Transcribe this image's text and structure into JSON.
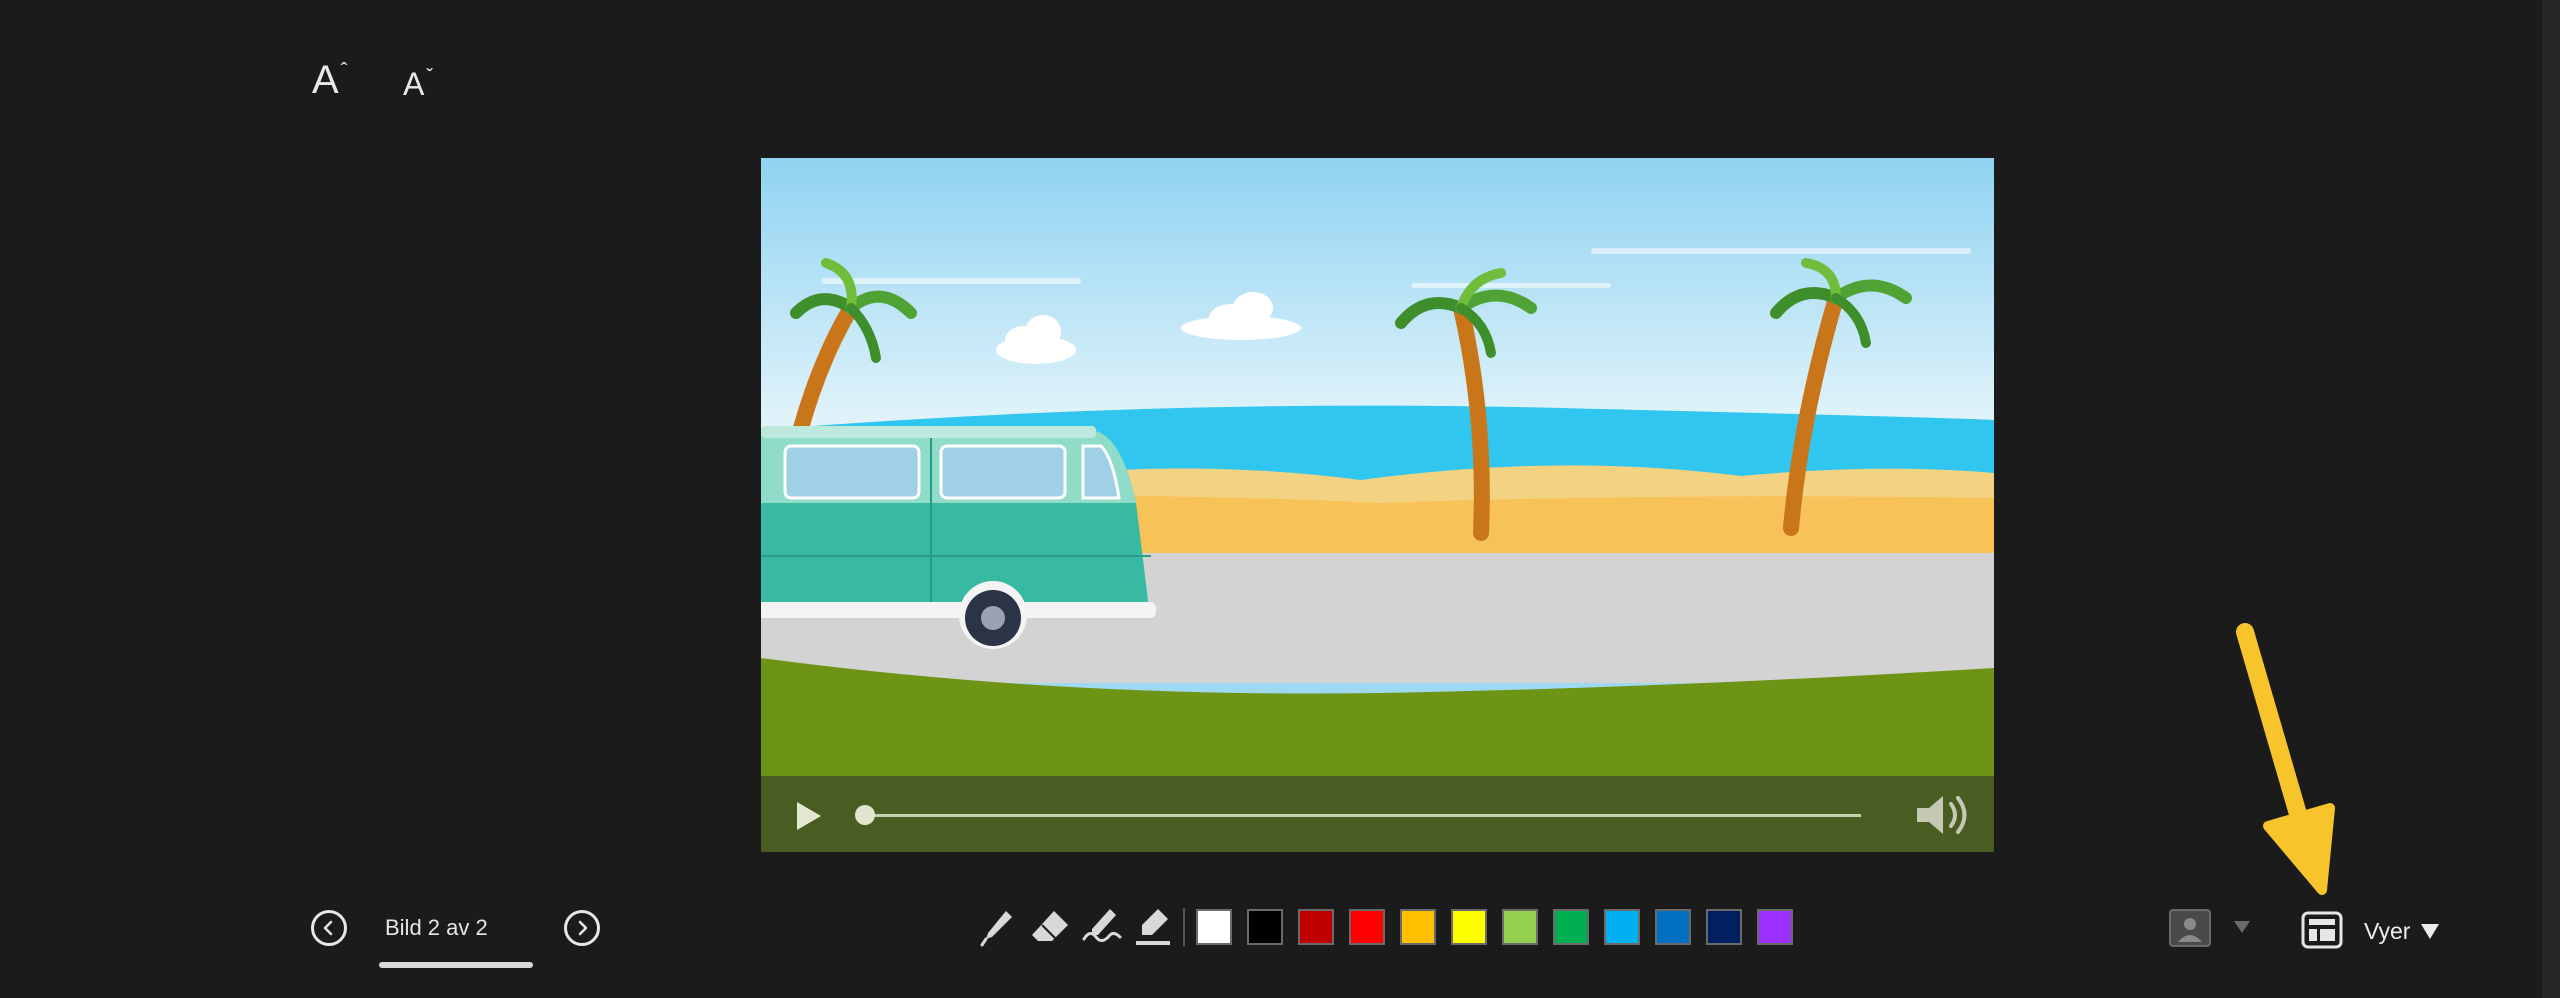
{
  "toolbar_top": {
    "increase_font_label": "A",
    "increase_font_mark": "ˆ",
    "decrease_font_label": "A",
    "decrease_font_mark": "ˇ"
  },
  "navigation": {
    "slide_counter": "Bild 2 av 2"
  },
  "video": {
    "progress": 0
  },
  "ink_tools": [
    "pen-icon",
    "eraser-icon",
    "laser-pointer-icon",
    "highlighter-icon"
  ],
  "colors": [
    "#ffffff",
    "#000000",
    "#c00000",
    "#ff0000",
    "#ffc000",
    "#ffff00",
    "#92d050",
    "#00b050",
    "#00b0f0",
    "#0070c0",
    "#002060",
    "#9b30ff"
  ],
  "views": {
    "label": "Vyer"
  },
  "annotation": {
    "arrow_color": "#f7c52b"
  }
}
